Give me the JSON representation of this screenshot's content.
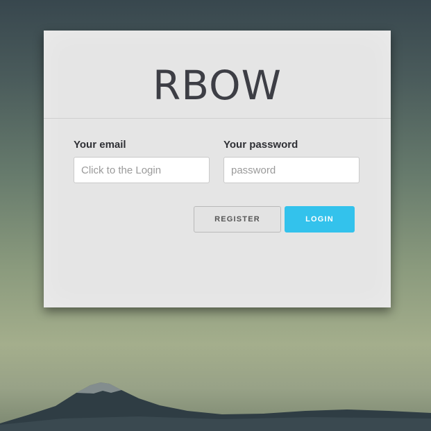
{
  "header": {
    "title": "RBOW"
  },
  "form": {
    "email": {
      "label": "Your email",
      "value": "",
      "placeholder": "Click to the Login"
    },
    "password": {
      "label": "Your password",
      "value": "",
      "placeholder": "password"
    }
  },
  "actions": {
    "register_label": "REGISTER",
    "login_label": "LOGIN"
  },
  "colors": {
    "accent": "#33c2ec",
    "card_background": "#e5e5e5",
    "title_text": "#3d3e45"
  }
}
